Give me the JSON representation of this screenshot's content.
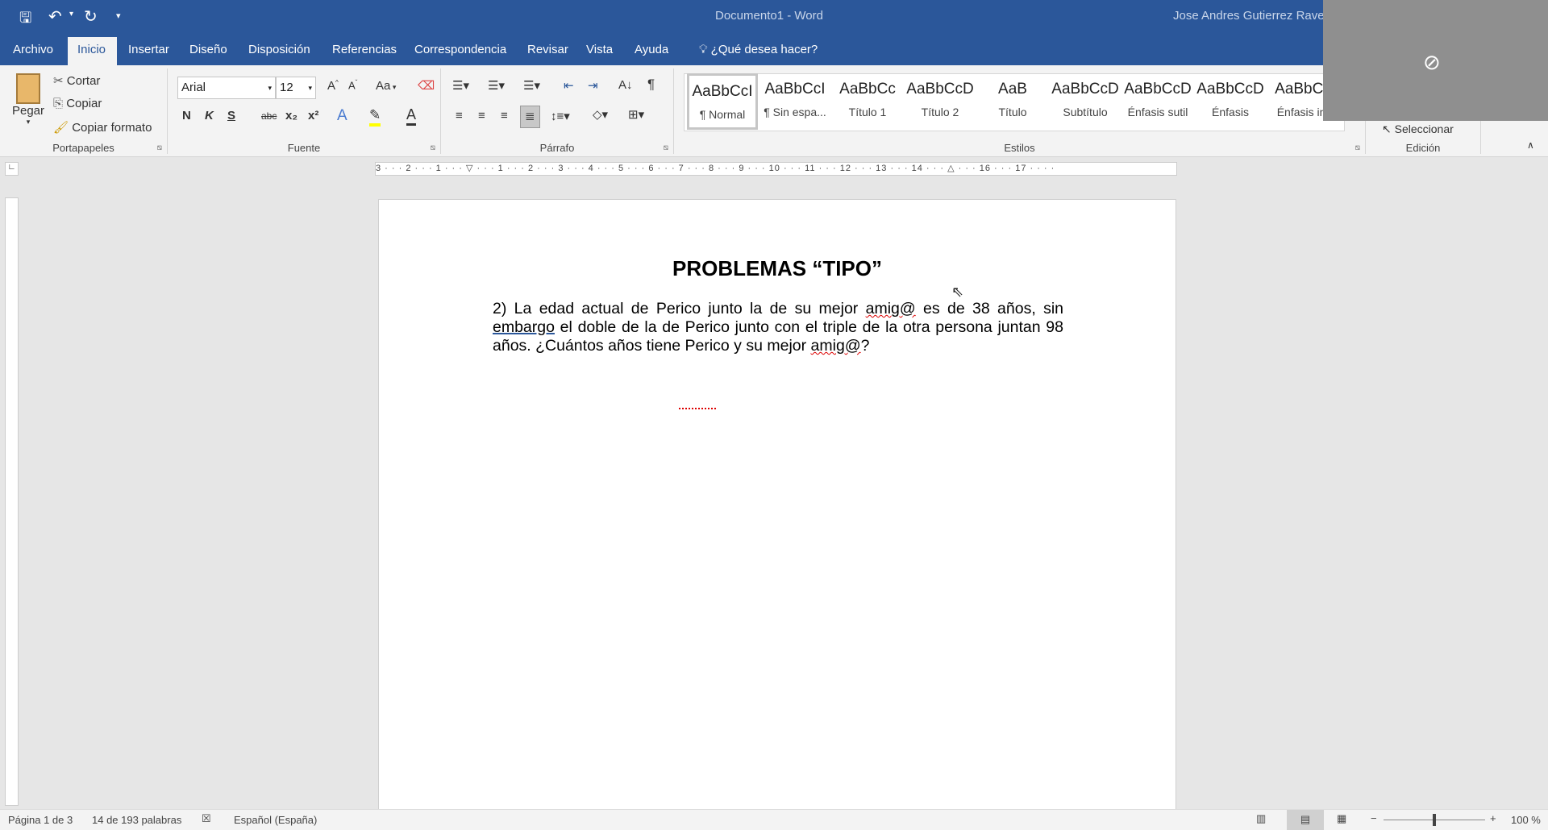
{
  "title_bar": {
    "doc_title": "Documento1  -  Word",
    "user": "Jose Andres Gutierrez Rave"
  },
  "quick_access": {
    "save": "save-icon",
    "undo": "undo-icon",
    "redo": "redo-icon",
    "customize": "▾"
  },
  "tabs": [
    "Archivo",
    "Inicio",
    "Insertar",
    "Diseño",
    "Disposición",
    "Referencias",
    "Correspondencia",
    "Revisar",
    "Vista",
    "Ayuda"
  ],
  "tell_me": "¿Qué desea hacer?",
  "ribbon": {
    "clipboard": {
      "label": "Portapapeles",
      "paste": "Pegar",
      "cut": "Cortar",
      "copy": "Copiar",
      "format_painter": "Copiar formato"
    },
    "font": {
      "label": "Fuente",
      "font_name": "Arial",
      "font_size": "12",
      "case": "Aa",
      "bold": "N",
      "italic": "K",
      "underline": "S",
      "strike": "abc",
      "sub": "x₂",
      "sup": "x²",
      "color": "A"
    },
    "paragraph": {
      "label": "Párrafo",
      "pilcrow": "¶"
    },
    "styles": {
      "label": "Estilos",
      "items": [
        {
          "sample": "AaBbCcI",
          "name": "¶ Normal",
          "color": "#000000"
        },
        {
          "sample": "AaBbCcI",
          "name": "¶ Sin espa...",
          "color": "#000000"
        },
        {
          "sample": "AaBbCc",
          "name": "Título 1",
          "color": "#2f5496"
        },
        {
          "sample": "AaBbCcD",
          "name": "Título 2",
          "color": "#2f5496"
        },
        {
          "sample": "AaB",
          "name": "Título",
          "color": "#000000"
        },
        {
          "sample": "AaBbCcD",
          "name": "Subtítulo",
          "color": "#595959"
        },
        {
          "sample": "AaBbCcD",
          "name": "Énfasis sutil",
          "color": "#404040"
        },
        {
          "sample": "AaBbCcD",
          "name": "Énfasis",
          "color": "#000000"
        },
        {
          "sample": "AaBbCc",
          "name": "Énfasis int",
          "color": "#4472c4"
        }
      ]
    },
    "editing": {
      "label": "Edición",
      "select": "Seleccionar"
    }
  },
  "ruler": {
    "ticks": "3 · · · 2 · · · 1 · · · ▽ · · · 1 · · · 2 · · · 3 · · · 4 · · · 5 · · · 6 · · · 7 · · · 8 · · · 9 · · · 10 · · · 11 · · · 12 · · · 13 · · · 14 · · · △ · · · 16 · · · 17 · · · ·"
  },
  "document": {
    "title": "PROBLEMAS “TIPO”",
    "p1": "2) La edad actual de Perico junto la de su mejor ",
    "w1": "amig@",
    "p2": " es de 38 años, sin ",
    "w2": "embargo",
    "p3": " el doble de la de Perico junto con el triple de la otra persona juntan 98 años. ¿Cuántos años tiene Perico y su mejor ",
    "w3": "amig@",
    "p4": "?"
  },
  "status": {
    "page": "Página 1 de 3",
    "words": "14 de 193 palabras",
    "language": "Español (España)",
    "zoom": "100 %",
    "zoom_percent": 100
  }
}
